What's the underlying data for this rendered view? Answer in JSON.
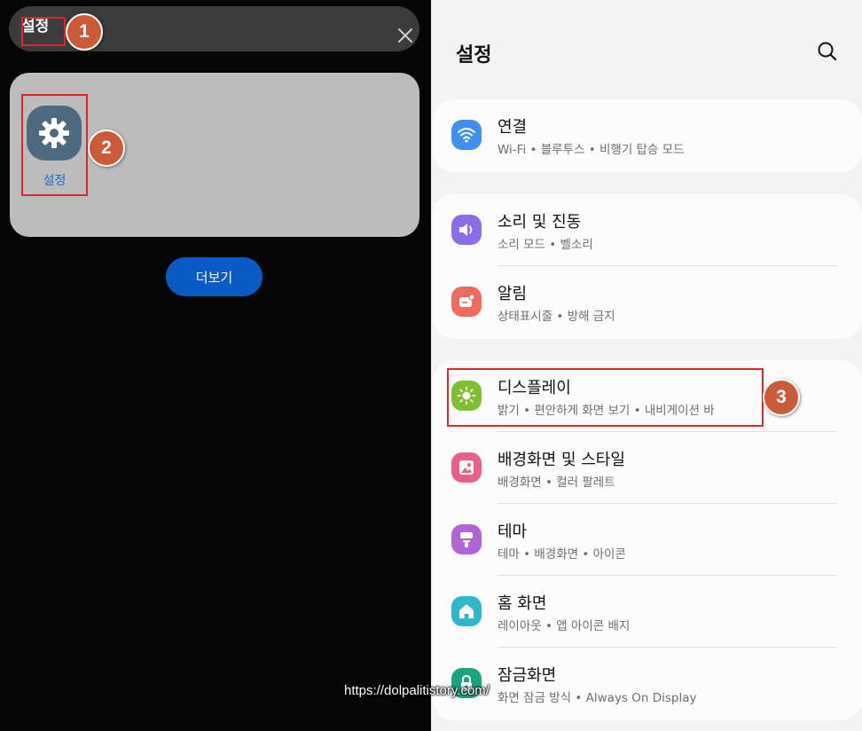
{
  "search": {
    "query": "설정"
  },
  "steps": [
    "1",
    "2",
    "3"
  ],
  "result": {
    "app_label": "설정"
  },
  "more_button": "더보기",
  "settings": {
    "title": "설정",
    "groups": [
      {
        "items": [
          {
            "title": "연결",
            "subtitle": "Wi-Fi  •  블루투스  •  비행기 탑승 모드",
            "icon": "wifi-icon",
            "color": "#3f8fef"
          }
        ]
      },
      {
        "items": [
          {
            "title": "소리 및 진동",
            "subtitle": "소리 모드  •  벨소리",
            "icon": "speaker-icon",
            "color": "#8c6ce8"
          },
          {
            "title": "알림",
            "subtitle": "상태표시줄  •  방해 금지",
            "icon": "notification-icon",
            "color": "#f06a5e"
          }
        ]
      },
      {
        "items": [
          {
            "title": "디스플레이",
            "subtitle": "밝기  •  편안하게 화면 보기  •  내비게이션 바",
            "icon": "brightness-icon",
            "color": "#7fbf2f"
          },
          {
            "title": "배경화면 및 스타일",
            "subtitle": "배경화면  •  컬러 팔레트",
            "icon": "image-icon",
            "color": "#e85f8a"
          },
          {
            "title": "테마",
            "subtitle": "테마  •  배경화면  •  아이콘",
            "icon": "paint-brush-icon",
            "color": "#b263d8"
          },
          {
            "title": "홈 화면",
            "subtitle": "레이아웃  •  앱 아이콘 배지",
            "icon": "home-icon",
            "color": "#2fb7c9"
          },
          {
            "title": "잠금화면",
            "subtitle": "화면 잠금 방식  •  Always On Display",
            "icon": "lock-icon",
            "color": "#1aa37f"
          }
        ]
      }
    ]
  },
  "watermark": "https://dolpalitistory.com/"
}
